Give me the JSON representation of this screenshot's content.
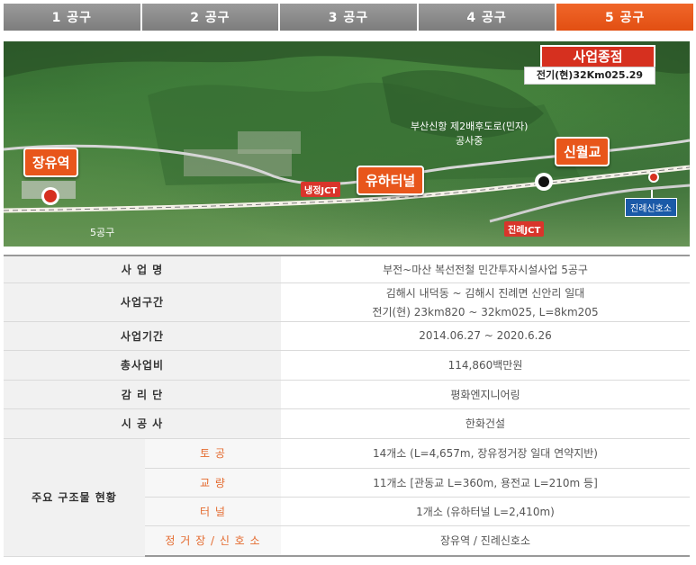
{
  "tabs": [
    {
      "label": "1 공구",
      "active": false
    },
    {
      "label": "2 공구",
      "active": false
    },
    {
      "label": "3 공구",
      "active": false
    },
    {
      "label": "4 공구",
      "active": false
    },
    {
      "label": "5 공구",
      "active": true
    }
  ],
  "map": {
    "end_title": "사업종점",
    "end_sub": "전기(현)32Km025.29",
    "station_start": "장유역",
    "tunnel": "유하터널",
    "bridge": "신월교",
    "road_label_line1": "부산신항 제2배후도로(민자)",
    "road_label_line2": "공사중",
    "jct1": "냉정JCT",
    "jct2": "진례JCT",
    "signal_station": "진례신호소",
    "section_label": "5공구"
  },
  "info": {
    "project_name_label": "사 업 명",
    "project_name_value": "부전~마산 복선전철 민간투자시설사업 5공구",
    "section_label": "사업구간",
    "section_value_line1": "김해시 내덕동 ~ 김해시 진례면 신안리 일대",
    "section_value_line2": "전기(현) 23km820 ~ 32km025, L=8km205",
    "period_label": "사업기간",
    "period_value": "2014.06.27 ~ 2020.6.26",
    "cost_label": "총사업비",
    "cost_value": "114,860백만원",
    "supervisor_label": "감 리 단",
    "supervisor_value": "평화엔지니어링",
    "contractor_label": "시 공 사",
    "contractor_value": "한화건설",
    "structures_label": "주요 구조물 현황",
    "earthwork_label": "토 공",
    "earthwork_value": "14개소 (L=4,657m, 장유정거장 일대 연약지반)",
    "bridge_label": "교 량",
    "bridge_value": "11개소 [관동교 L=360m, 용전교 L=210m 등]",
    "tunnel_label": "터 널",
    "tunnel_value": "1개소 (유하터널 L=2,410m)",
    "station_label": "정 거 장 / 신 호 소",
    "station_value": "장유역 / 진례신호소"
  },
  "colors": {
    "tab_active": "#e8561b",
    "tab_inactive": "#8a8a8a",
    "accent_text": "#e46a2e"
  }
}
